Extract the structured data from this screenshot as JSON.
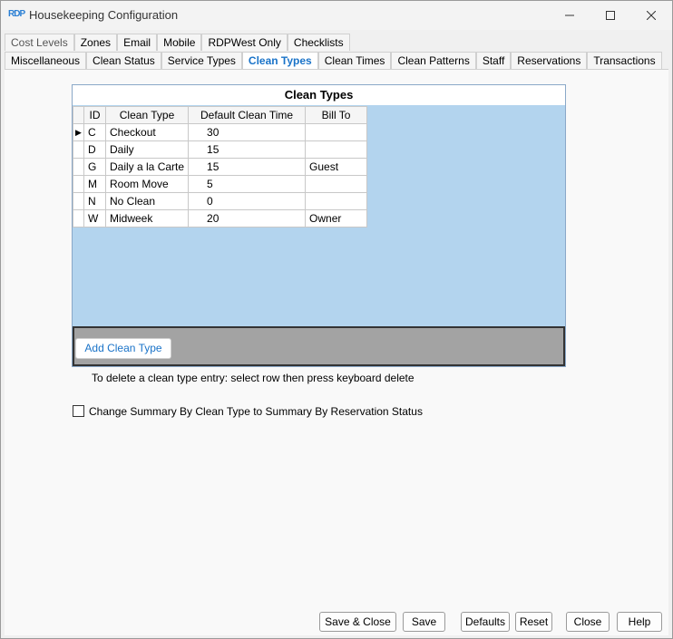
{
  "window": {
    "app_logo": "RDP",
    "title": "Housekeeping Configuration"
  },
  "tabs_row1": [
    "Cost Levels",
    "Zones",
    "Email",
    "Mobile",
    "RDPWest Only",
    "Checklists"
  ],
  "tabs_row2": [
    "Miscellaneous",
    "Clean Status",
    "Service Types",
    "Clean Types",
    "Clean Times",
    "Clean Patterns",
    "Staff",
    "Reservations",
    "Transactions"
  ],
  "active_tab": "Clean Types",
  "grid": {
    "title": "Clean Types",
    "columns": [
      "ID",
      "Clean Type",
      "Default Clean Time",
      "Bill To"
    ],
    "rows": [
      {
        "id": "C",
        "name": "Checkout",
        "time": "30",
        "bill": ""
      },
      {
        "id": "D",
        "name": "Daily",
        "time": "15",
        "bill": ""
      },
      {
        "id": "G",
        "name": "Daily a la Carte",
        "time": "15",
        "bill": "Guest"
      },
      {
        "id": "M",
        "name": "Room Move",
        "time": "5",
        "bill": ""
      },
      {
        "id": "N",
        "name": "No Clean",
        "time": "0",
        "bill": ""
      },
      {
        "id": "W",
        "name": "Midweek",
        "time": "20",
        "bill": "Owner"
      }
    ],
    "add_button": "Add Clean Type"
  },
  "hint": "To delete a clean type entry: select row then press keyboard delete",
  "checkbox_label": "Change Summary By Clean Type to Summary By Reservation Status",
  "buttons": {
    "save_close": "Save & Close",
    "save": "Save",
    "defaults": "Defaults",
    "reset": "Reset",
    "close": "Close",
    "help": "Help"
  }
}
